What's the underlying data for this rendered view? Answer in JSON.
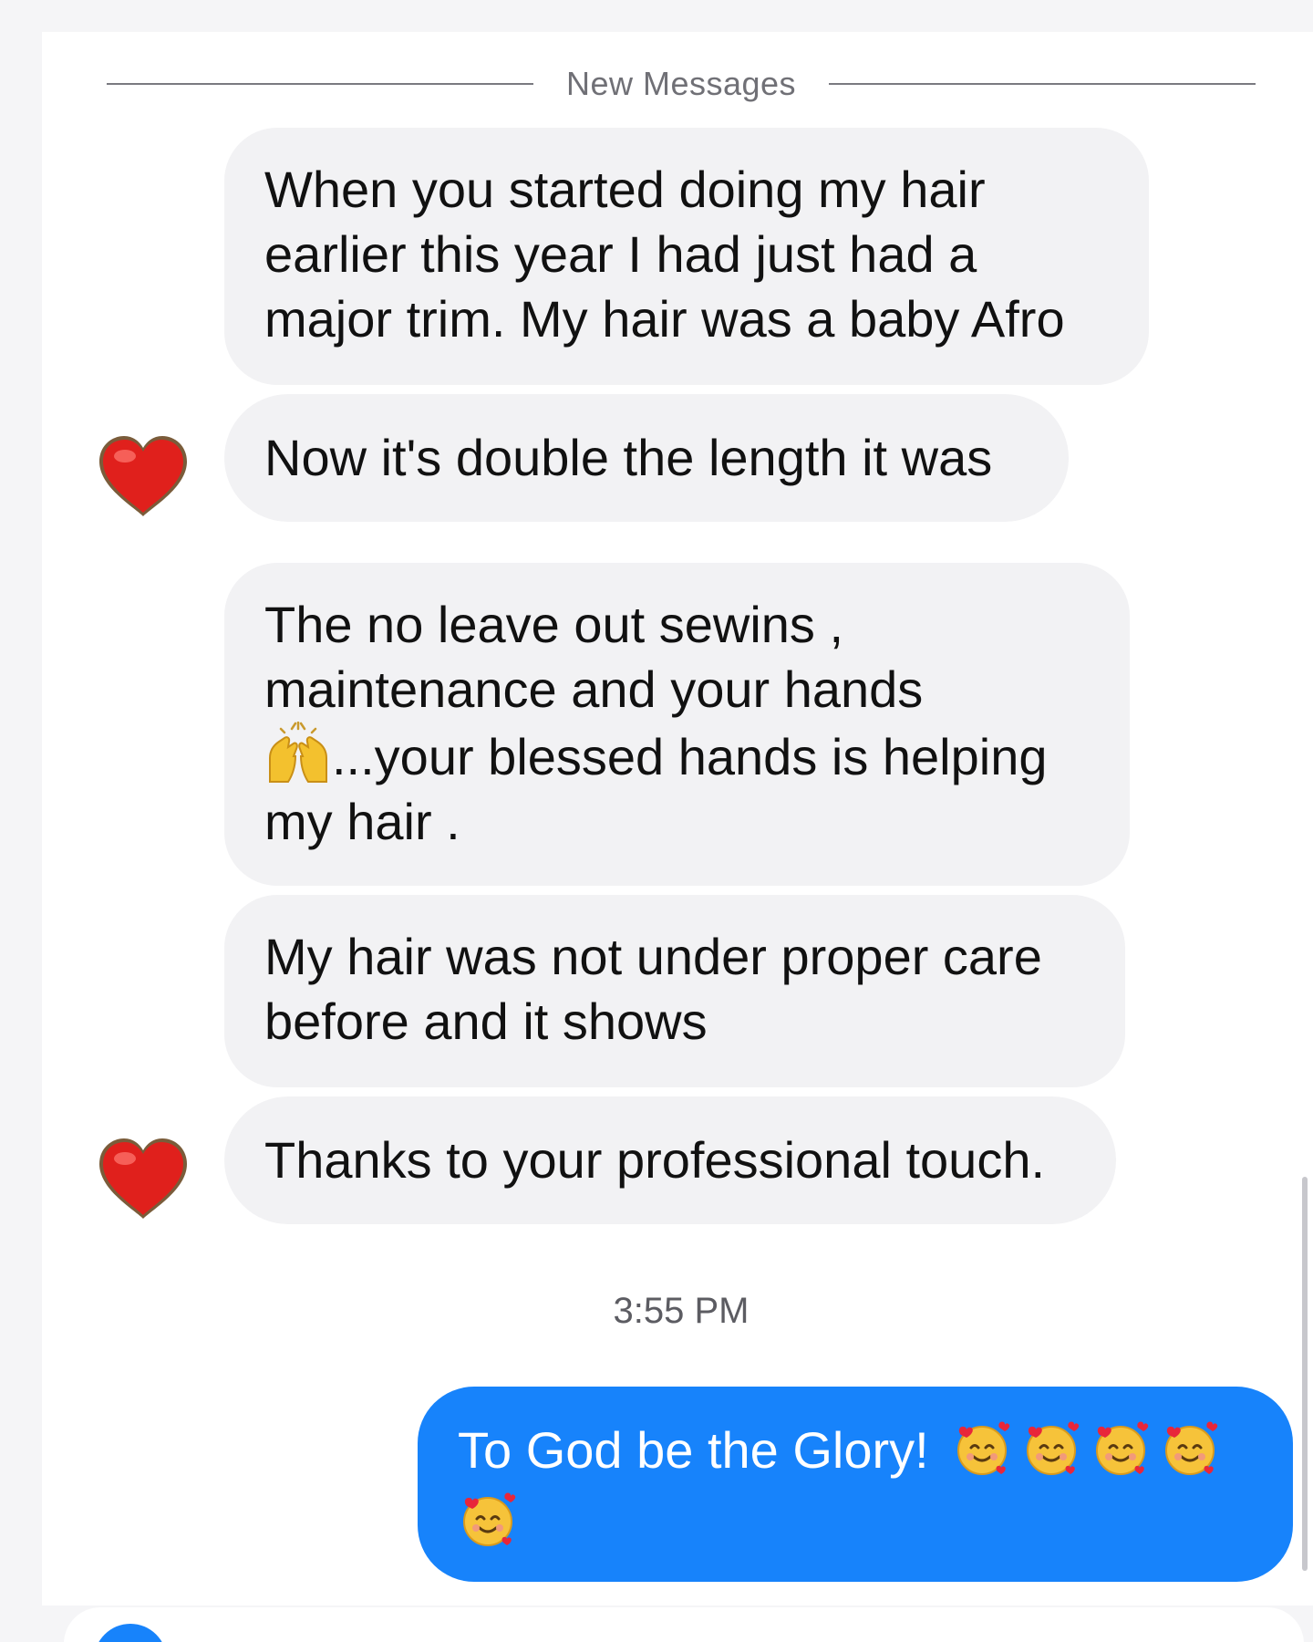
{
  "divider": {
    "label": "New Messages"
  },
  "messages": [
    {
      "side": "incoming",
      "lines": [
        "When you started doing my hair",
        "earlier this year I had just had a",
        "major trim.  My hair was a baby Afro"
      ]
    },
    {
      "side": "incoming",
      "text": "Now it's double the length it was",
      "reaction": "heart-icon"
    },
    {
      "side": "incoming",
      "lines": [
        "The no leave out sewins ,",
        "maintenance and your hands",
        "...your blessed hands is helping",
        "my hair ."
      ],
      "inline_emoji": "raising-hands-icon"
    },
    {
      "side": "incoming",
      "lines": [
        "My hair was not under proper care",
        "before and it shows"
      ]
    },
    {
      "side": "incoming",
      "text": "Thanks to your professional touch.",
      "reaction": "heart-icon"
    }
  ],
  "timestamp": "3:55 PM",
  "outgoing": {
    "text": "To God be the Glory!",
    "emoji": "smiling-face-with-hearts-icon",
    "emoji_count": 5
  },
  "colors": {
    "incoming_bubble": "#f2f2f4",
    "outgoing_bubble": "#1783fb",
    "heart": "#e0201c"
  }
}
